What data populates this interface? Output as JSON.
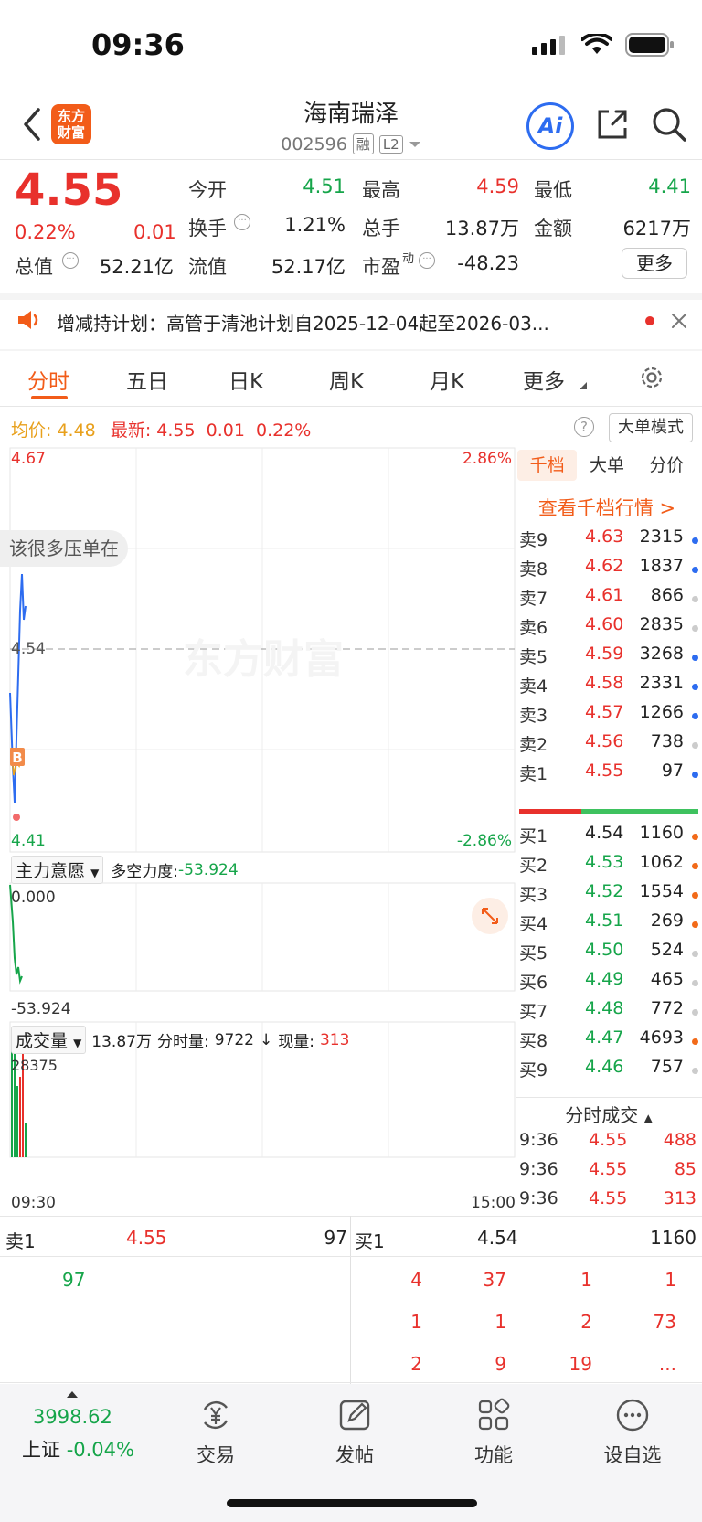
{
  "status_bar": {
    "time": "09:36"
  },
  "header": {
    "logo_text": "东方财富",
    "stock_name": "海南瑞泽",
    "stock_code": "002596",
    "tag_rong": "融",
    "tag_l2": "L2",
    "ai_label": "Ai"
  },
  "quote": {
    "price": "4.55",
    "change_pct": "0.22%",
    "change": "0.01",
    "open_label": "今开",
    "open": "4.51",
    "high_label": "最高",
    "high": "4.59",
    "low_label": "最低",
    "low": "4.41",
    "turnover_label": "换手",
    "turnover": "1.21%",
    "volume_label": "总手",
    "volume": "13.87万",
    "amount_label": "金额",
    "amount": "6217万",
    "total_mv_label": "总值",
    "total_mv": "52.21亿",
    "float_mv_label": "流值",
    "float_mv": "52.17亿",
    "pe_label": "市盈",
    "pe_sup": "动",
    "pe": "-48.23",
    "more_label": "更多"
  },
  "notice": {
    "text": "增减持计划：高管于清池计划自2025-12-04起至2026-03..."
  },
  "tabs": [
    "分时",
    "五日",
    "日K",
    "周K",
    "月K",
    "更多"
  ],
  "chart_info": {
    "avg_label": "均价:",
    "avg": "4.48",
    "last_label": "最新:",
    "last": "4.55",
    "chg": "0.01",
    "chg_pct": "0.22%",
    "big_order_mode": "大单模式",
    "y_top": "4.67",
    "y_mid": "4.54",
    "y_bot": "4.41",
    "pct_top": "2.86%",
    "pct_bot": "-2.86%",
    "bubble": "该很多压单在",
    "watermark": "东方财富",
    "b_marker": "B"
  },
  "indicator": {
    "name": "主力意愿",
    "power_label": "多空力度:",
    "power": "-53.924",
    "y_top": "0.000",
    "y_bot": "-53.924"
  },
  "volume_panel": {
    "name": "成交量",
    "total": "13.87万",
    "minute_label": "分时量:",
    "minute": "9722",
    "now_label": "现量:",
    "now": "313",
    "y_top": "28375",
    "x_start": "09:30",
    "x_end": "15:00"
  },
  "order_book": {
    "tabs": [
      "千档",
      "大单",
      "分价"
    ],
    "link": "查看千档行情 >",
    "sells": [
      {
        "label": "卖9",
        "price": "4.63",
        "vol": "2315",
        "dot": "blue"
      },
      {
        "label": "卖8",
        "price": "4.62",
        "vol": "1837",
        "dot": "blue"
      },
      {
        "label": "卖7",
        "price": "4.61",
        "vol": "866",
        "dot": "gray"
      },
      {
        "label": "卖6",
        "price": "4.60",
        "vol": "2835",
        "dot": "gray"
      },
      {
        "label": "卖5",
        "price": "4.59",
        "vol": "3268",
        "dot": "blue"
      },
      {
        "label": "卖4",
        "price": "4.58",
        "vol": "2331",
        "dot": "blue"
      },
      {
        "label": "卖3",
        "price": "4.57",
        "vol": "1266",
        "dot": "blue"
      },
      {
        "label": "卖2",
        "price": "4.56",
        "vol": "738",
        "dot": "gray"
      },
      {
        "label": "卖1",
        "price": "4.55",
        "vol": "97",
        "dot": "blue"
      }
    ],
    "buys": [
      {
        "label": "买1",
        "price": "4.54",
        "vol": "1160",
        "dot": "orange"
      },
      {
        "label": "买2",
        "price": "4.53",
        "vol": "1062",
        "dot": "orange"
      },
      {
        "label": "买3",
        "price": "4.52",
        "vol": "1554",
        "dot": "orange"
      },
      {
        "label": "买4",
        "price": "4.51",
        "vol": "269",
        "dot": "orange"
      },
      {
        "label": "买5",
        "price": "4.50",
        "vol": "524",
        "dot": "gray"
      },
      {
        "label": "买6",
        "price": "4.49",
        "vol": "465",
        "dot": "gray"
      },
      {
        "label": "买7",
        "price": "4.48",
        "vol": "772",
        "dot": "gray"
      },
      {
        "label": "买8",
        "price": "4.47",
        "vol": "4693",
        "dot": "orange"
      },
      {
        "label": "买9",
        "price": "4.46",
        "vol": "757",
        "dot": "gray"
      }
    ],
    "trades_title": "分时成交",
    "trades": [
      {
        "time": "9:36",
        "price": "4.55",
        "vol": "488"
      },
      {
        "time": "9:36",
        "price": "4.55",
        "vol": "85"
      },
      {
        "time": "9:36",
        "price": "4.55",
        "vol": "313"
      }
    ]
  },
  "detail": {
    "sell1_label": "卖1",
    "sell1_price": "4.55",
    "sell1_vol": "97",
    "buy1_label": "买1",
    "buy1_price": "4.54",
    "buy1_vol": "1160",
    "sell_queue": [
      "97"
    ],
    "buy_queue": [
      [
        "4",
        "37",
        "1",
        "1"
      ],
      [
        "1",
        "1",
        "2",
        "73"
      ],
      [
        "2",
        "9",
        "19",
        "..."
      ]
    ]
  },
  "bottom_nav": {
    "index_value": "3998.62",
    "index_name": "上证",
    "index_chg": "-0.04%",
    "items": [
      "交易",
      "发帖",
      "功能",
      "设自选"
    ]
  }
}
